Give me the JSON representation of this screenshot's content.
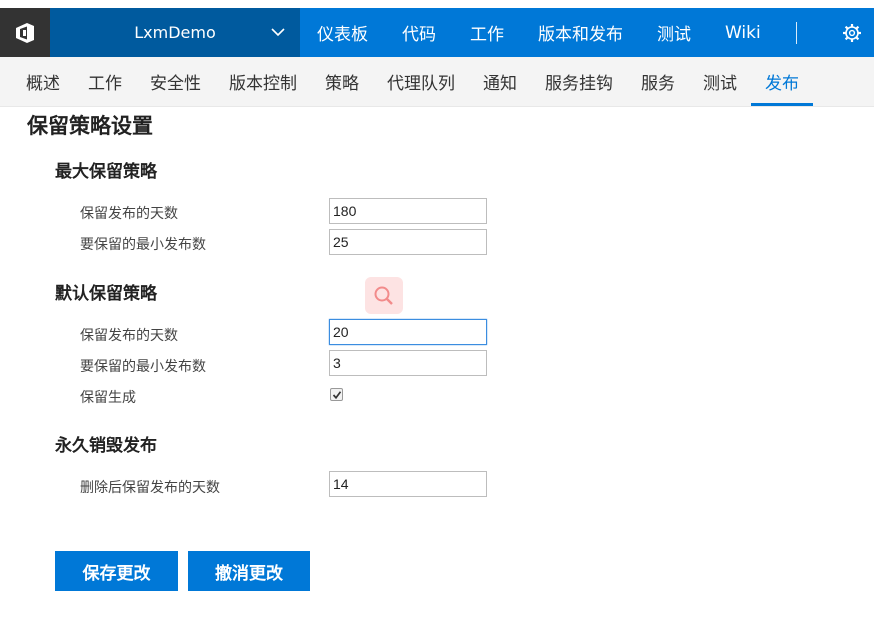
{
  "header": {
    "project_name": "LxmDemo",
    "nav": [
      "仪表板",
      "代码",
      "工作",
      "版本和发布",
      "测试",
      "Wiki"
    ]
  },
  "subnav": {
    "items": [
      "概述",
      "工作",
      "安全性",
      "版本控制",
      "策略",
      "代理队列",
      "通知",
      "服务挂钩",
      "服务",
      "测试",
      "发布"
    ],
    "active": "发布"
  },
  "page": {
    "title": "保留策略设置"
  },
  "max_policy": {
    "title": "最大保留策略",
    "days_label": "保留发布的天数",
    "days_value": "180",
    "min_releases_label": "要保留的最小发布数",
    "min_releases_value": "25"
  },
  "default_policy": {
    "title": "默认保留策略",
    "days_label": "保留发布的天数",
    "days_value": "20",
    "min_releases_label": "要保留的最小发布数",
    "min_releases_value": "3",
    "retain_builds_label": "保留生成",
    "retain_builds_checked": true
  },
  "permanent_delete": {
    "title": "永久销毁发布",
    "days_label": "删除后保留发布的天数",
    "days_value": "14"
  },
  "actions": {
    "save_label": "保存更改",
    "undo_label": "撤消更改"
  },
  "colors": {
    "accent": "#0078d7",
    "project_bg": "#005a9e",
    "logo_bg": "#333333"
  }
}
